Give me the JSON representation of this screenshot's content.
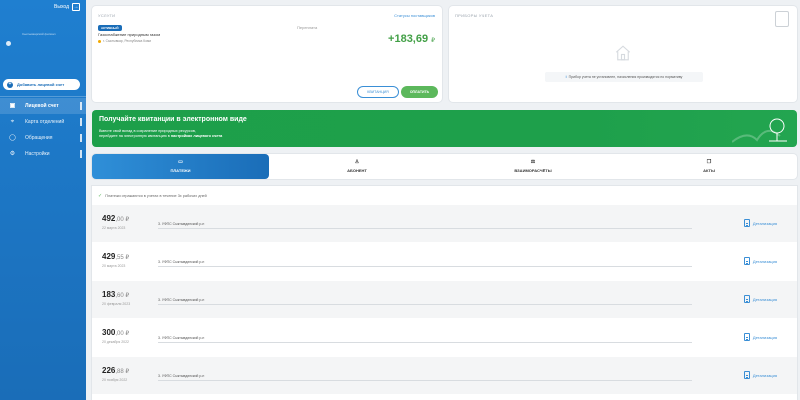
{
  "sidebar": {
    "logout_label": "Выход",
    "user_line": "Сыктывкарский филиал",
    "add_account_label": "Добавить лицевой счет",
    "items": [
      {
        "label": "Лицевой счет",
        "icon": "card-icon",
        "active": true
      },
      {
        "label": "Карта отделений",
        "icon": "map-pin-icon",
        "active": false
      },
      {
        "label": "Обращения",
        "icon": "chat-icon",
        "active": false
      },
      {
        "label": "Настройки",
        "icon": "gear-icon",
        "active": false
      }
    ]
  },
  "payments_card": {
    "section_label": "УСЛУГИ",
    "statuses_link": "Статусы поставщиков",
    "badge": "АКТИВНЫЙ",
    "service_name": "Газоснабжение природным газом",
    "address": "г. Сыктывкар, Республика Коми",
    "overpay_label": "Переплата",
    "amount": "+183,69",
    "currency": "₽",
    "receipt_button": "КВИТАНЦИЯ",
    "pay_button": "ОПЛАТИТЬ"
  },
  "meters_card": {
    "section_label": "ПРИБОРЫ УЧЕТА",
    "note": "Прибор учета не установлен, начисления производятся по нормативу"
  },
  "banner": {
    "title": "Получайте квитанции в электронном виде",
    "text_line1": "Вместе свой вклад в сохранение природных ресурсов,",
    "text_line2_prefix": "перейдите на электронную квитанцию в ",
    "text_line2_bold": "настройках лицевого счета"
  },
  "tabs": [
    {
      "label": "ПЛАТЕЖИ",
      "icon": "payments-icon",
      "active": true
    },
    {
      "label": "АБОНЕНТ",
      "icon": "user-icon",
      "active": false
    },
    {
      "label": "ВЗАИМОРАСЧЁТЫ",
      "icon": "scale-icon",
      "active": false
    },
    {
      "label": "АКТЫ",
      "icon": "copy-icon",
      "active": false
    }
  ],
  "list": {
    "note": "Платежи отражаются в учетах в течение 3х рабочих дней",
    "detail_label": "Детализация",
    "rows": [
      {
        "int": "492",
        "dec": ",00 ₽",
        "date": "22 марта 2023",
        "payee": "3. УФПС Сыктывдинский р-н"
      },
      {
        "int": "429",
        "dec": ",55 ₽",
        "date": "20 марта 2023",
        "payee": "3. УФПС Сыктывдинский р-н"
      },
      {
        "int": "183",
        "dec": ",60 ₽",
        "date": "20 февраля 2023",
        "payee": "3. УФПС Сыктывдинский р-н"
      },
      {
        "int": "300",
        "dec": ",00 ₽",
        "date": "20 декабря 2022",
        "payee": "3. УФПС Сыктывдинский р-н"
      },
      {
        "int": "226",
        "dec": ",88 ₽",
        "date": "20 ноября 2022",
        "payee": "3. УФПС Сыктывдинский р-н"
      }
    ]
  }
}
